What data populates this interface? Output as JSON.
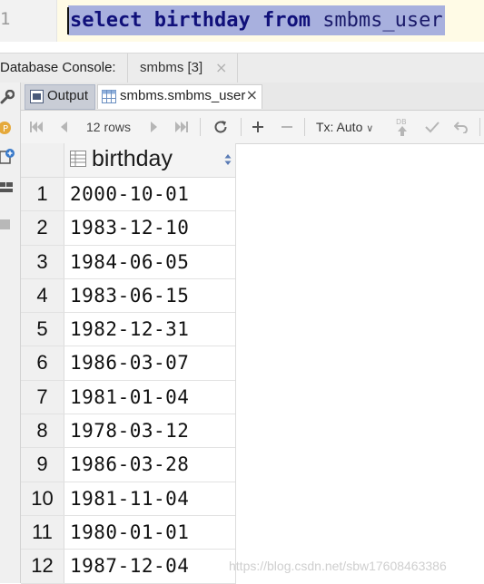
{
  "editor": {
    "line_number": "1",
    "sql_keyword_1": "select",
    "sql_column": "birthday",
    "sql_keyword_2": "from",
    "sql_table": "smbms_user"
  },
  "console": {
    "label": "Database Console:",
    "tab_label": "smbms [3]",
    "tab_close": "×"
  },
  "result_tabs": {
    "output_label": "Output",
    "table_label": "smbms.smbms_user",
    "table_close": "×"
  },
  "toolbar": {
    "rows_label": "12 rows",
    "tx_label": "Tx: Auto",
    "db_label": "DB"
  },
  "grid": {
    "column_header": "birthday",
    "rows": [
      {
        "num": "1",
        "value": "2000-10-01"
      },
      {
        "num": "2",
        "value": "1983-12-10"
      },
      {
        "num": "3",
        "value": "1984-06-05"
      },
      {
        "num": "4",
        "value": "1983-06-15"
      },
      {
        "num": "5",
        "value": "1982-12-31"
      },
      {
        "num": "6",
        "value": "1986-03-07"
      },
      {
        "num": "7",
        "value": "1981-01-04"
      },
      {
        "num": "8",
        "value": "1978-03-12"
      },
      {
        "num": "9",
        "value": "1986-03-28"
      },
      {
        "num": "10",
        "value": "1981-11-04"
      },
      {
        "num": "11",
        "value": "1980-01-01"
      },
      {
        "num": "12",
        "value": "1987-12-04"
      }
    ]
  },
  "watermark": "https://blog.csdn.net/sbw17608463386",
  "colors": {
    "selection": "#a8b0de",
    "output_tab": "#c9cdd6"
  }
}
